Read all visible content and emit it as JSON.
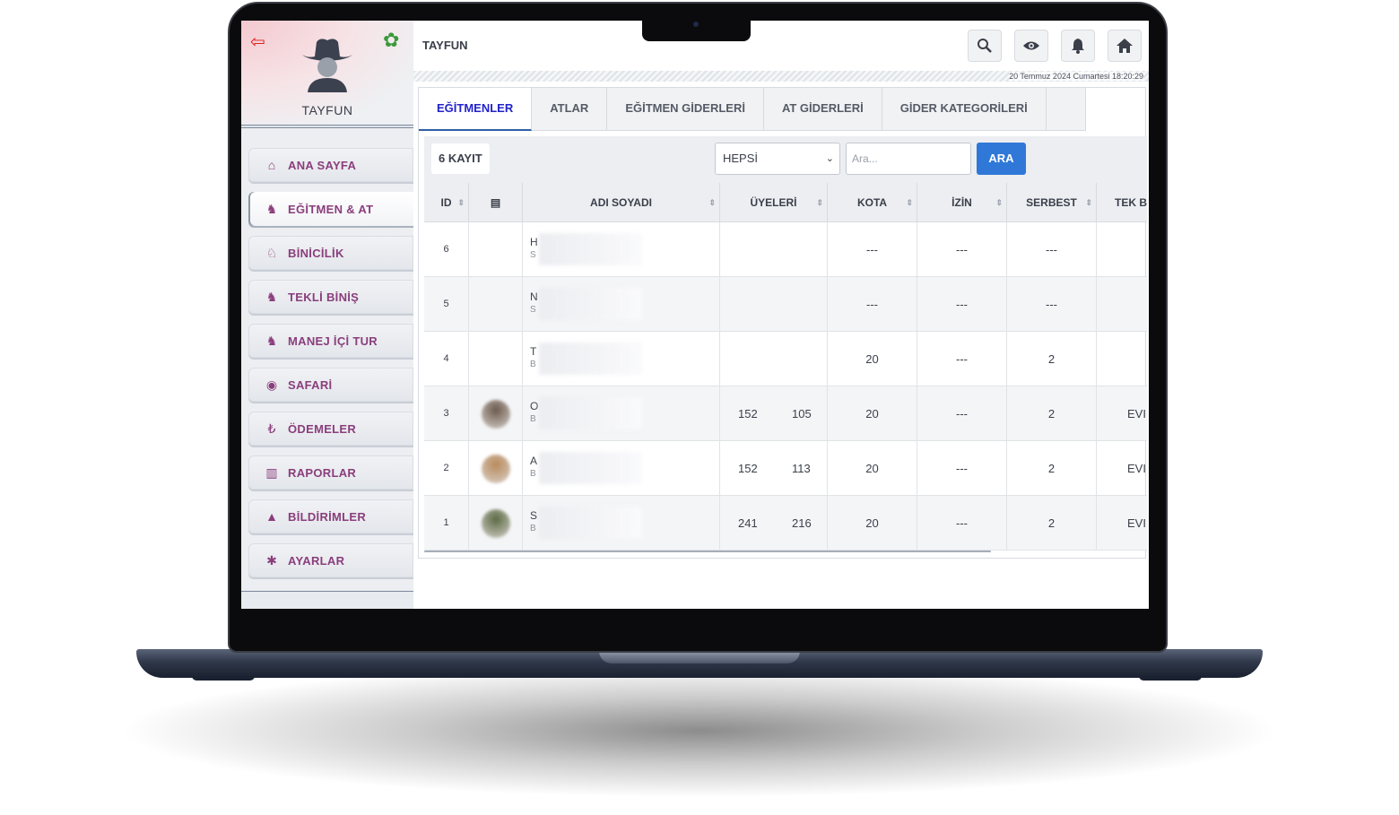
{
  "app": {
    "title": "TAYFUN",
    "datetime": "20 Temmuz 2024 Cumartesi 18:20:29"
  },
  "user": {
    "name": "TAYFUN"
  },
  "icons": {
    "logout": "logout-icon",
    "settings": "gear-icon",
    "search": "search-icon",
    "eye": "eye-icon",
    "bell": "bell-icon",
    "home": "home-icon"
  },
  "colors": {
    "menu_text": "#8a3e7c",
    "active_tab": "#2222cc",
    "search_button": "#2f78d8",
    "logout": "#e02020",
    "settings": "#3a9a3a"
  },
  "sidebar": {
    "items": [
      {
        "label": "ANA SAYFA",
        "icon": "home-icon",
        "glyph": "⌂"
      },
      {
        "label": "EĞİTMEN & AT",
        "icon": "instructor-icon",
        "glyph": "♞"
      },
      {
        "label": "BİNİCİLİK",
        "icon": "horse-head-icon",
        "glyph": "♘"
      },
      {
        "label": "TEKLİ BİNİŞ",
        "icon": "horse-icon",
        "glyph": "♞"
      },
      {
        "label": "MANEJ İÇİ TUR",
        "icon": "horse-icon",
        "glyph": "♞"
      },
      {
        "label": "SAFARİ",
        "icon": "compass-icon",
        "glyph": "◉"
      },
      {
        "label": "ÖDEMELER",
        "icon": "lira-icon",
        "glyph": "₺"
      },
      {
        "label": "RAPORLAR",
        "icon": "chart-icon",
        "glyph": "▥"
      },
      {
        "label": "BİLDİRİMLER",
        "icon": "bell-icon",
        "glyph": "▲"
      },
      {
        "label": "AYARLAR",
        "icon": "gear-icon",
        "glyph": "✱"
      }
    ]
  },
  "tabs": [
    "EĞİTMENLER",
    "ATLAR",
    "EĞİTMEN GİDERLERİ",
    "AT GİDERLERİ",
    "GİDER KATEGORİLERİ"
  ],
  "toolbar": {
    "count": "6 KAYIT",
    "filter": "HEPSİ",
    "search_placeholder": "Ara...",
    "search_button": "ARA"
  },
  "table": {
    "columns": [
      "ID",
      "",
      "ADI SOYADI",
      "ÜYELERİ",
      "KOTA",
      "İZİN",
      "SERBEST",
      "TEK B"
    ],
    "rows": [
      {
        "id": "6",
        "name_initial": "H",
        "sub_initial": "S",
        "m1": "",
        "m2": "",
        "kota": "---",
        "izin": "---",
        "serbest": "---",
        "tek": ""
      },
      {
        "id": "5",
        "name_initial": "N",
        "sub_initial": "S",
        "m1": "",
        "m2": "",
        "kota": "---",
        "izin": "---",
        "serbest": "---",
        "tek": ""
      },
      {
        "id": "4",
        "name_initial": "T",
        "sub_initial": "B",
        "m1": "",
        "m2": "",
        "kota": "20",
        "izin": "---",
        "serbest": "2",
        "tek": ""
      },
      {
        "id": "3",
        "name_initial": "O",
        "sub_initial": "B",
        "m1": "152",
        "m2": "105",
        "kota": "20",
        "izin": "---",
        "serbest": "2",
        "tek": "EVI"
      },
      {
        "id": "2",
        "name_initial": "A",
        "sub_initial": "B",
        "m1": "152",
        "m2": "113",
        "kota": "20",
        "izin": "---",
        "serbest": "2",
        "tek": "EVI"
      },
      {
        "id": "1",
        "name_initial": "S",
        "sub_initial": "B",
        "m1": "241",
        "m2": "216",
        "kota": "20",
        "izin": "---",
        "serbest": "2",
        "tek": "EVI"
      }
    ]
  }
}
